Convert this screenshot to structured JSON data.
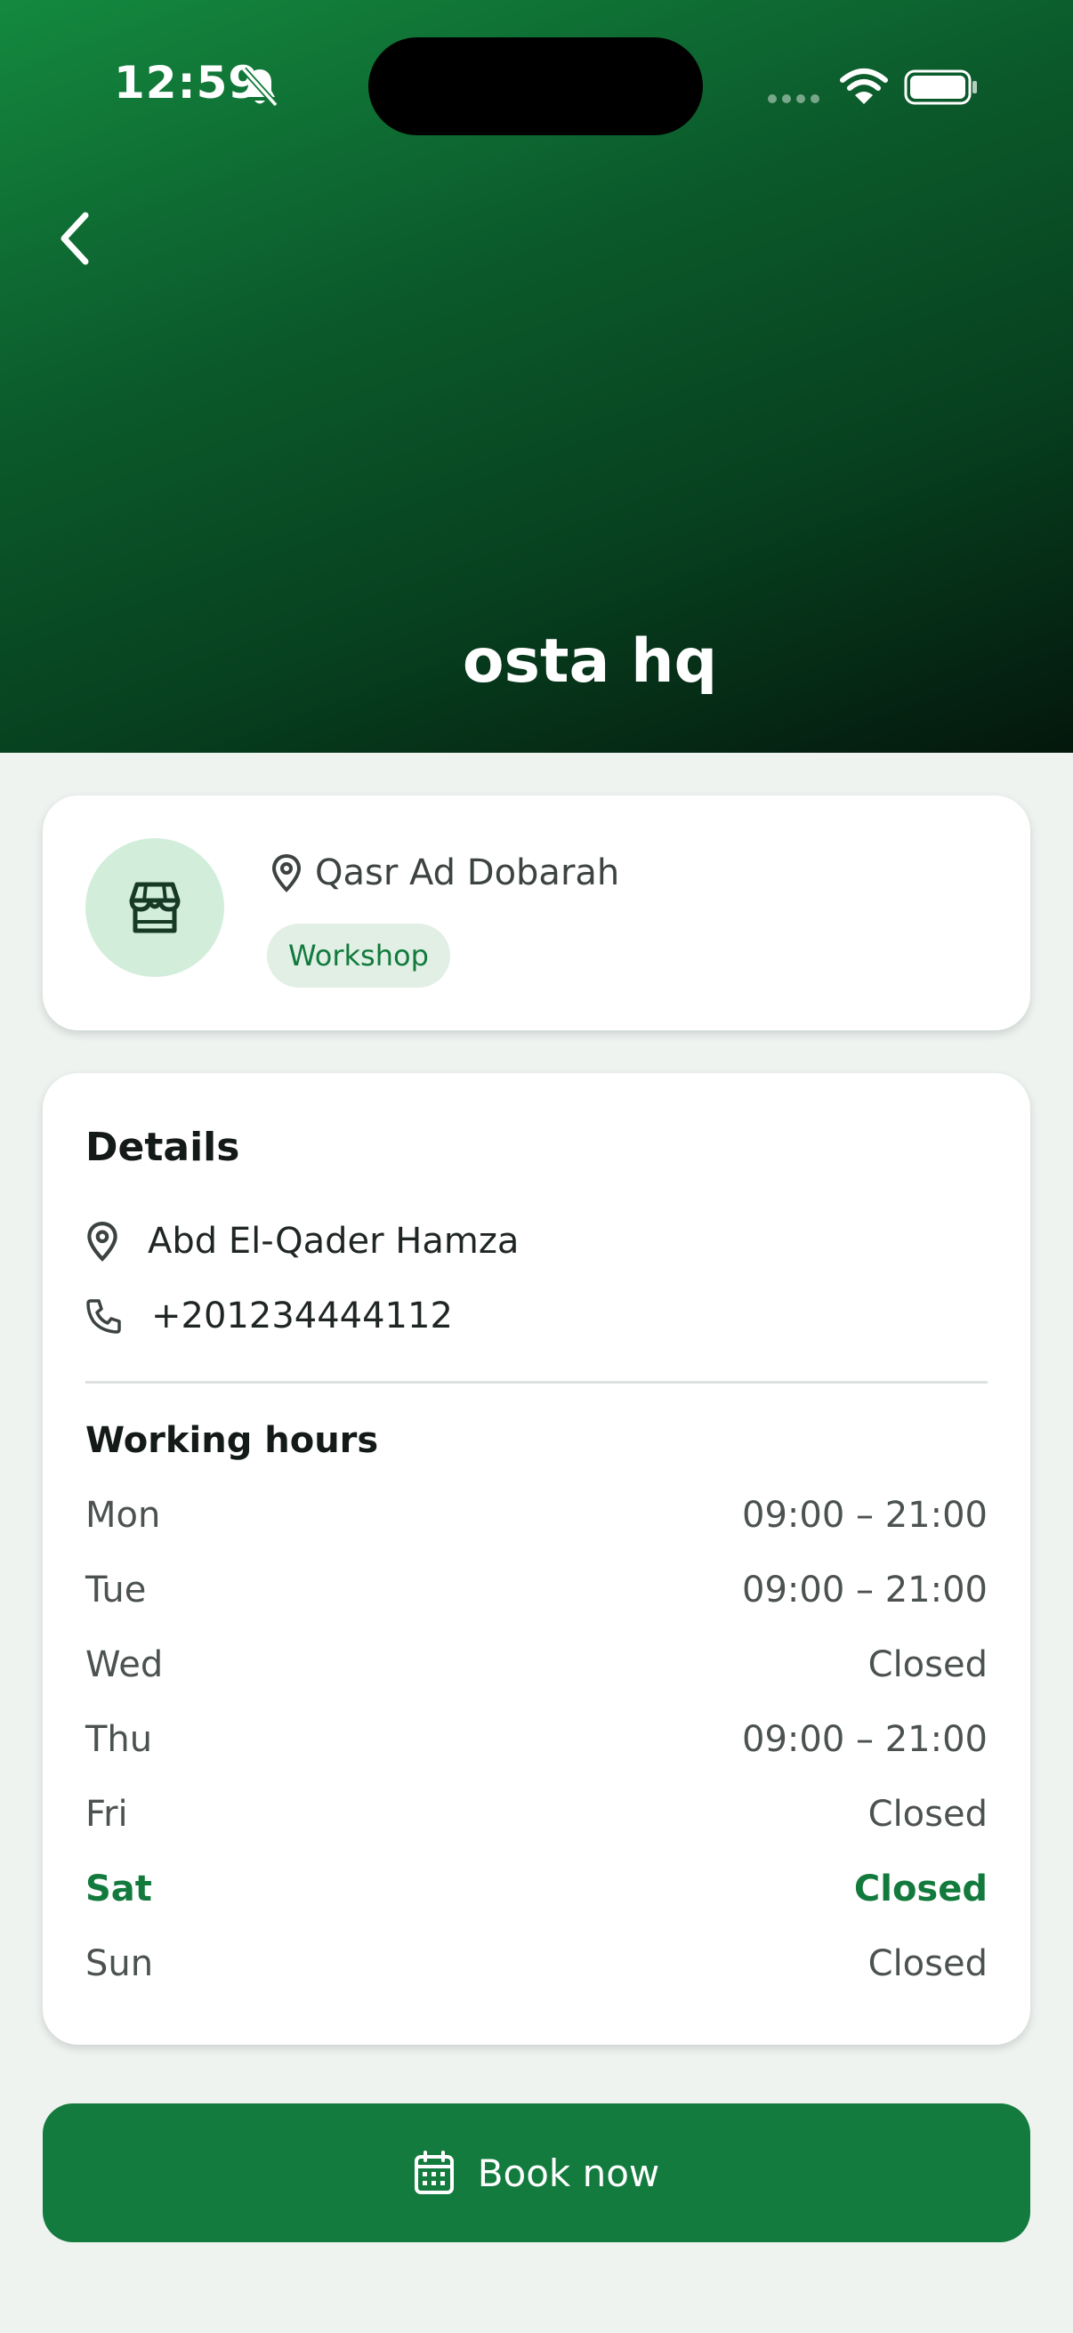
{
  "status_bar": {
    "time": "12:59",
    "icons": [
      "bell-slash-icon",
      "signal-dots-icon",
      "wifi-icon",
      "battery-icon"
    ]
  },
  "header": {
    "title": "osta hq",
    "back_icon": "chevron-left-icon"
  },
  "summary": {
    "avatar_icon": "storefront-icon",
    "location": "Qasr Ad Dobarah",
    "category": "Workshop"
  },
  "details": {
    "heading": "Details",
    "address": "Abd El-Qader Hamza",
    "phone": "+201234444112",
    "hours_heading": "Working hours",
    "hours": [
      {
        "day": "Mon",
        "time": "09:00 – 21:00"
      },
      {
        "day": "Tue",
        "time": "09:00 – 21:00"
      },
      {
        "day": "Wed",
        "time": "Closed"
      },
      {
        "day": "Thu",
        "time": "09:00 – 21:00"
      },
      {
        "day": "Fri",
        "time": "Closed"
      },
      {
        "day": "Sat",
        "time": "Closed"
      },
      {
        "day": "Sun",
        "time": "Closed"
      }
    ],
    "highlighted_day": "Sat"
  },
  "actions": {
    "book_label": "Book now",
    "book_icon": "calendar-icon"
  },
  "colors": {
    "brand_green": "#137b3d",
    "chip_bg": "#e1efe5",
    "avatar_bg": "#d3eddb",
    "page_bg": "#eef3f0"
  }
}
